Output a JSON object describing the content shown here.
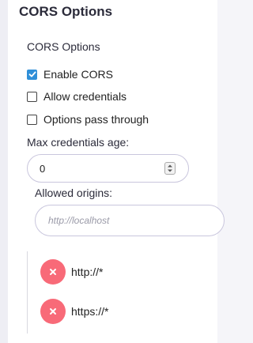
{
  "section": {
    "title": "CORS Options"
  },
  "group": {
    "title": "CORS Options"
  },
  "options": [
    {
      "label": "Enable CORS",
      "checked": true
    },
    {
      "label": "Allow credentials",
      "checked": false
    },
    {
      "label": "Options pass through",
      "checked": false
    }
  ],
  "max_age": {
    "label": "Max credentials age:",
    "value": "0"
  },
  "allowed_origins": {
    "label": "Allowed origins:",
    "placeholder": "http://localhost",
    "items": [
      {
        "value": "http://*"
      },
      {
        "value": "https://*"
      }
    ]
  },
  "icons": {
    "check": "checkmark-icon",
    "remove": "close-icon",
    "spinner": "spinner-arrows-icon"
  },
  "colors": {
    "checkbox_checked": "#2f8fd8",
    "remove_button": "#f86a78",
    "input_border": "#c9c6dd"
  }
}
